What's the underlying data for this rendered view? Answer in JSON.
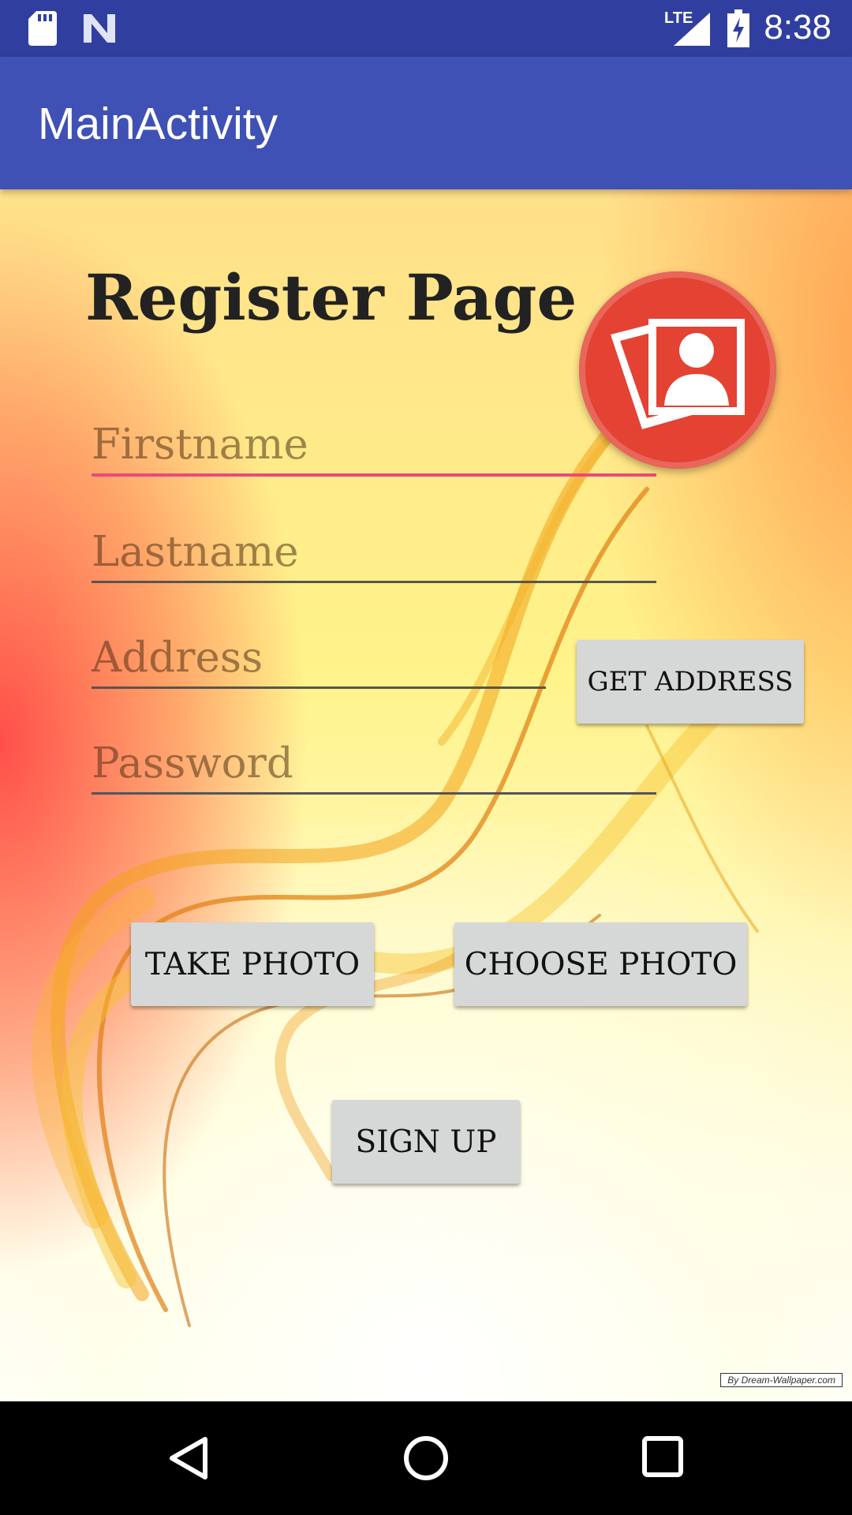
{
  "status_bar": {
    "time": "8:38",
    "network": "LTE",
    "icons": [
      "sd-card-icon",
      "n-notification-icon",
      "lte-signal-icon",
      "battery-charging-icon"
    ]
  },
  "app_bar": {
    "title": "MainActivity"
  },
  "page": {
    "title": "Register Page",
    "photo_icon": "photo-gallery-icon",
    "fields": {
      "firstname_placeholder": "Firstname",
      "lastname_placeholder": "Lastname",
      "address_placeholder": "Address",
      "password_placeholder": "Password"
    },
    "buttons": {
      "get_address": "GET ADDRESS",
      "take_photo": "TAKE PHOTO",
      "choose_photo": "CHOOSE PHOTO",
      "sign_up": "SIGN UP"
    },
    "watermark": "By Dream-Wallpaper.com"
  },
  "nav_bar": {
    "icons": [
      "back-icon",
      "home-icon",
      "recents-icon"
    ]
  },
  "colors": {
    "status_bar": "#303F9F",
    "app_bar": "#3F51B5",
    "accent": "#E94A7B",
    "photo_button": "#E44233",
    "button_bg": "#D6D7D7"
  }
}
